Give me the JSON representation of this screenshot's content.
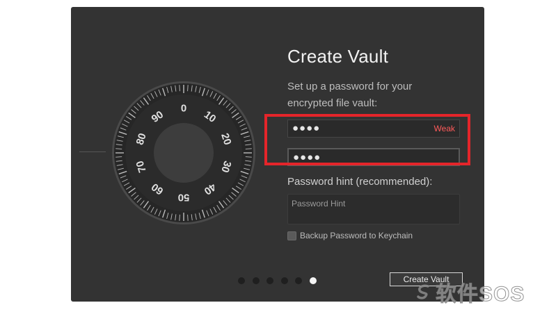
{
  "vault": {
    "title": "Create Vault",
    "subtitle": "Set up a password for your encrypted file vault:",
    "password": {
      "masked_value": "●●●●",
      "strength": "Weak",
      "strength_color": "#ff5b5b"
    },
    "confirm_password": {
      "masked_value": "●●●●"
    },
    "hint_label": "Password hint (recommended):",
    "hint_placeholder": "Password Hint",
    "keychain_label": "Backup Password to Keychain",
    "create_button": "Create Vault"
  },
  "dial": {
    "numbers": [
      "0",
      "10",
      "20",
      "30",
      "40",
      "50",
      "60",
      "70",
      "80",
      "90"
    ]
  },
  "pagination": {
    "total": 6,
    "active_index": 5
  },
  "watermark": {
    "text": "软件SOS",
    "icon": "sos-swirl-icon"
  },
  "colors": {
    "window_bg": "#333333",
    "highlight": "#e5252a",
    "accent_text": "#f2f2f2"
  }
}
